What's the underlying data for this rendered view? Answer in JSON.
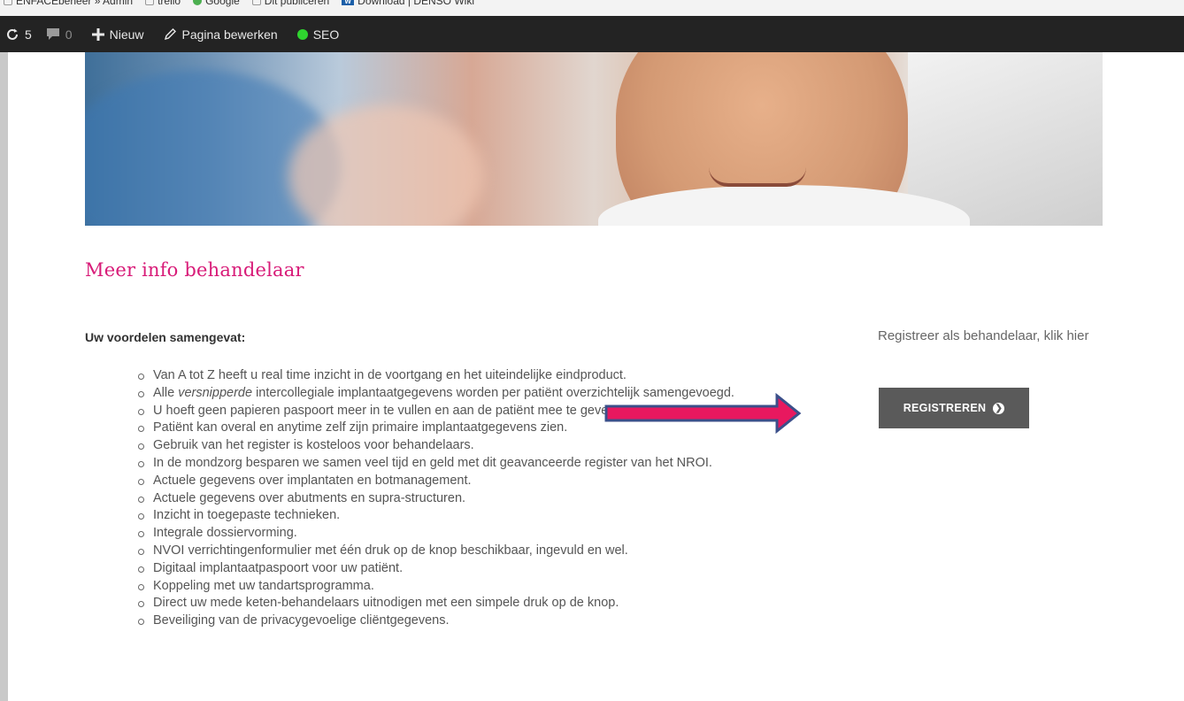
{
  "bookmarks": [
    {
      "label": "ENFACEbeheer » Admin",
      "icon": "folder-icon"
    },
    {
      "label": "trello",
      "icon": "folder-icon"
    },
    {
      "label": "Google",
      "icon": "google-icon"
    },
    {
      "label": "Dit publiceren",
      "icon": "folder-icon"
    },
    {
      "label": "Download | DENSO Wiki",
      "icon": "wiki-icon"
    }
  ],
  "adminbar": {
    "updates_count": "5",
    "comments_count": "0",
    "new_label": "Nieuw",
    "edit_label": "Pagina bewerken",
    "seo_label": "SEO",
    "colors": {
      "bar": "#232323",
      "seo_status": "#2fd42f"
    }
  },
  "page": {
    "title": "Meer info behandelaar",
    "subheading": "Uw voordelen samengevat:",
    "benefits": [
      "Van A tot Z heeft u real time inzicht in de voortgang en het uiteindelijke eindproduct.",
      "Alle versnipperde intercollegiale implantaatgegevens worden per patiënt overzichtelijk samengevoegd.",
      "U hoeft geen papieren paspoort meer in te vullen en aan de patiënt mee te geven.",
      "Patiënt kan overal en anytime zelf zijn primaire implantaatgegevens zien.",
      "Gebruik van het register is kosteloos voor behandelaars.",
      "In de mondzorg besparen we samen veel tijd en geld met dit geavanceerde register van het NROI.",
      "Actuele gegevens over implantaten en botmanagement.",
      "Actuele gegevens over abutments en supra-structuren.",
      "Inzicht in toegepaste technieken.",
      "Integrale dossiervorming.",
      "NVOI verrichtingenformulier met één druk op de knop beschikbaar, ingevuld en wel.",
      "Digitaal implantaatpaspoort voor uw patiënt.",
      "Koppeling met uw tandartsprogramma.",
      "Direct uw mede keten-behandelaars uitnodigen met een simpele druk op de knop.",
      "Beveiliging van de privacygevoelige cliëntgegevens."
    ],
    "benefit_2_parts": {
      "before": "Alle ",
      "em": "versnipperde",
      "after": " intercollegiale implantaatgegevens worden per patiënt overzichtelijk samengevoegd."
    },
    "sidebar_text": "Registreer als behandelaar, klik hier",
    "register_button": "REGISTREREN",
    "colors": {
      "title": "#d81b78",
      "button": "#5a5a5a",
      "annotation_arrow_fill": "#e8185f",
      "annotation_arrow_border": "#3b4f8a"
    }
  }
}
